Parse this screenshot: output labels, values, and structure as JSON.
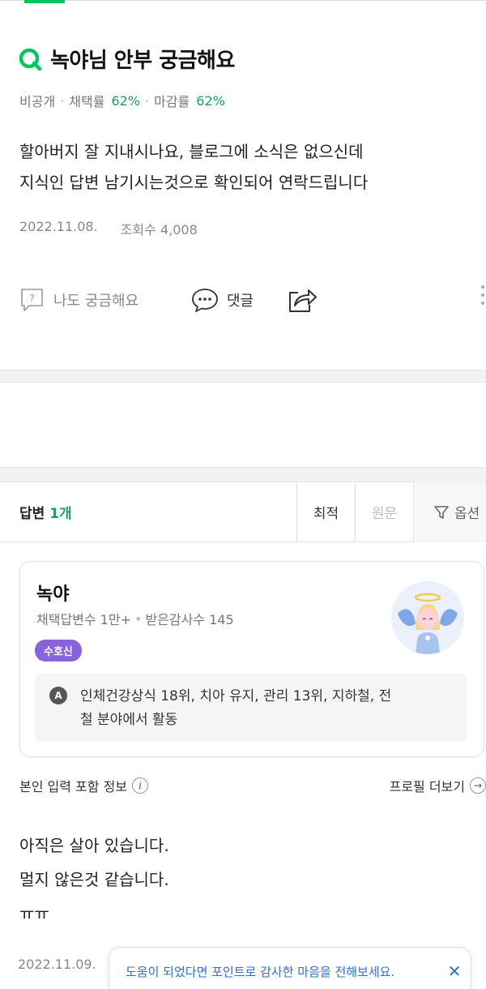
{
  "question": {
    "title": "녹야님 안부 궁금해요",
    "visibility": "비공개",
    "adopt_rate_label": "채택률",
    "adopt_rate_value": "62%",
    "close_rate_label": "마감률",
    "close_rate_value": "62%",
    "body_line1": "할아버지 잘 지내시나요, 블로그에 소식은 없으신데",
    "body_line2": "지식인 답변 남기시는것으로 확인되어 연락드립니다",
    "date": "2022.11.08.",
    "views": "조회수 4,008"
  },
  "actions": {
    "curious_label": "나도 궁금해요",
    "comment_label": "댓글"
  },
  "answers_header": {
    "title": "답변",
    "count": "1개",
    "sort_latest": "최적",
    "sort_original": "원문",
    "options_label": "옵션"
  },
  "profile": {
    "name": "녹야",
    "adopted_count": "채택답변수 1만+",
    "thanks_count": "받은감사수 145",
    "badge": "수호신",
    "field_line1": "인체건강상식 18위, 치아 유지, 관리 13위, 지하철, 전",
    "field_line2": "철 분야에서 활동"
  },
  "info_row": {
    "left_label": "본인 입력 포함 정보",
    "right_label": "프로필 더보기"
  },
  "answer": {
    "line1": "아직은 살아 있습니다.",
    "line2": "멀지 않은것 같습니다.",
    "line3": "ㅠㅠ",
    "date": "2022.11.09."
  },
  "toast": {
    "message": "도움이 되었다면 포인트로 감사한 마음을 전해보세요."
  },
  "colors": {
    "brand_green": "#03c75a",
    "rate_green": "#1d9c6a",
    "badge_purple": "#8a62d9",
    "toast_blue": "#2b6fd6"
  }
}
